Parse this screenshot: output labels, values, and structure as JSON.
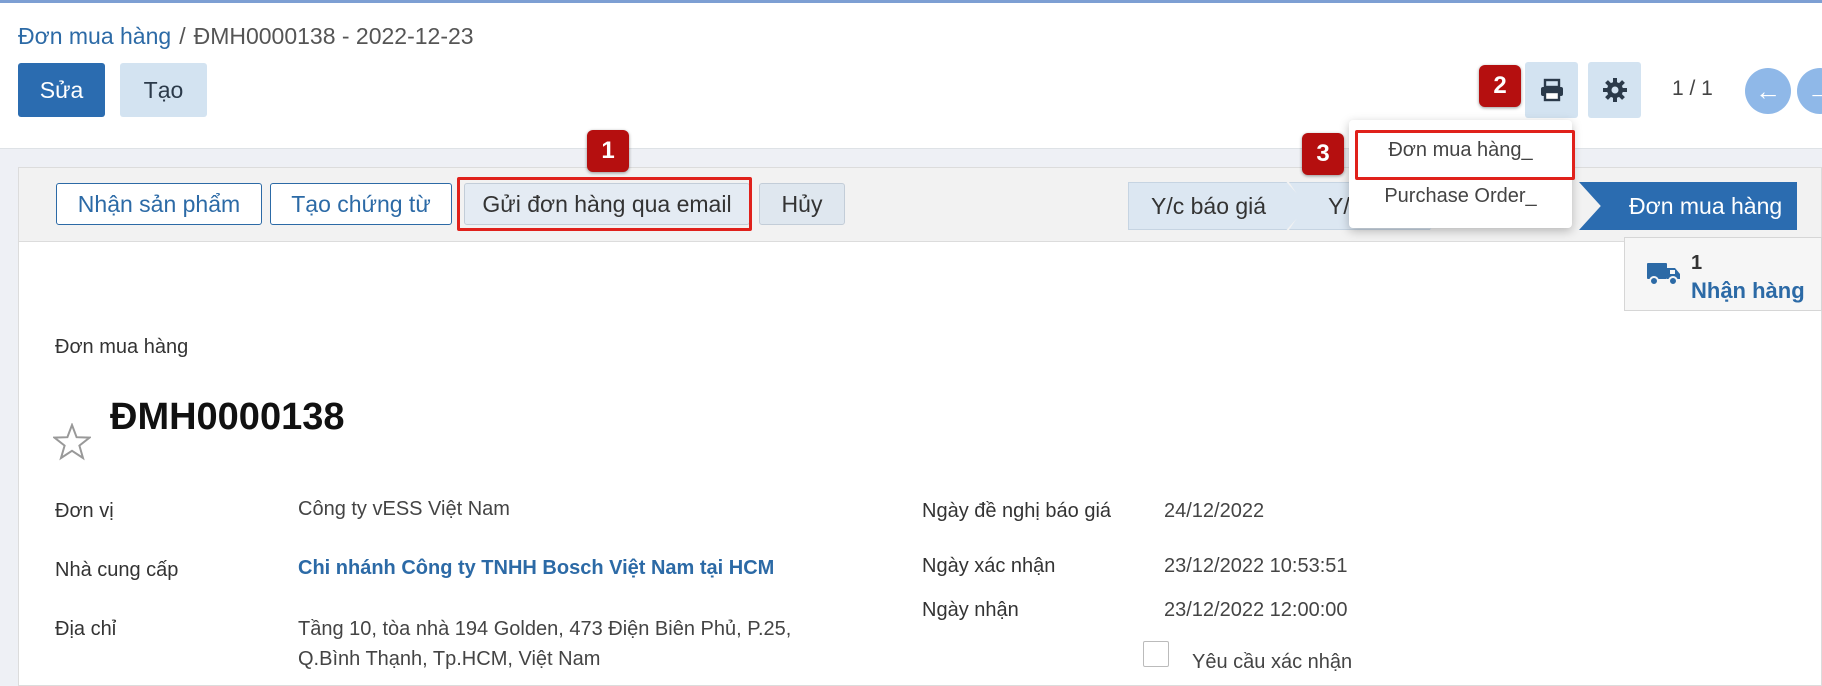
{
  "breadcrumb": {
    "parent": "Đơn mua hàng",
    "separator": "/",
    "current": "ĐMH0000138 - 2022-12-23"
  },
  "toolbar": {
    "edit_label": "Sửa",
    "create_label": "Tạo",
    "pager": "1 / 1"
  },
  "statusbar": {
    "buttons": [
      "Nhận sản phẩm",
      "Tạo chứng từ",
      "Gửi đơn hàng qua email",
      "Hủy"
    ],
    "stages": [
      "Y/c báo giá",
      "Y/c",
      "Đơn mua hàng"
    ],
    "active_stage": "Đơn mua hàng"
  },
  "print_menu": {
    "items": [
      "Đơn mua hàng_",
      "Purchase Order_"
    ]
  },
  "smart_button": {
    "count": "1",
    "label": "Nhận hàng"
  },
  "form": {
    "doc_type": "Đơn mua hàng",
    "title": "ĐMH0000138",
    "left_fields": {
      "unit_label": "Đơn vị",
      "unit_value": "Công ty vESS Việt Nam",
      "supplier_label": "Nhà cung cấp",
      "supplier_value": "Chi nhánh Công ty TNHH Bosch Việt Nam tại HCM",
      "address_label": "Địa chỉ",
      "address_line1": "Tầng 10, tòa nhà 194 Golden, 473 Điện Biên Phủ, P.25,",
      "address_line2": "Q.Bình Thạnh, Tp.HCM, Việt Nam"
    },
    "right_fields": {
      "quote_date_label": "Ngày đề nghị báo giá",
      "quote_date_value": "24/12/2022",
      "confirm_date_label": "Ngày xác nhận",
      "confirm_date_value": "23/12/2022 10:53:51",
      "receive_date_label": "Ngày nhận",
      "receive_date_value": "23/12/2022 12:00:00",
      "confirm_request_label": "Yêu cầu xác nhận",
      "confirm_request_checked": false
    }
  },
  "annotations": {
    "badge1": "1",
    "badge2": "2",
    "badge3": "3"
  },
  "colors": {
    "primary": "#2b6cb0",
    "link": "#2c6aa6",
    "highlight": "#e0211b",
    "badge": "#b50f0f"
  }
}
